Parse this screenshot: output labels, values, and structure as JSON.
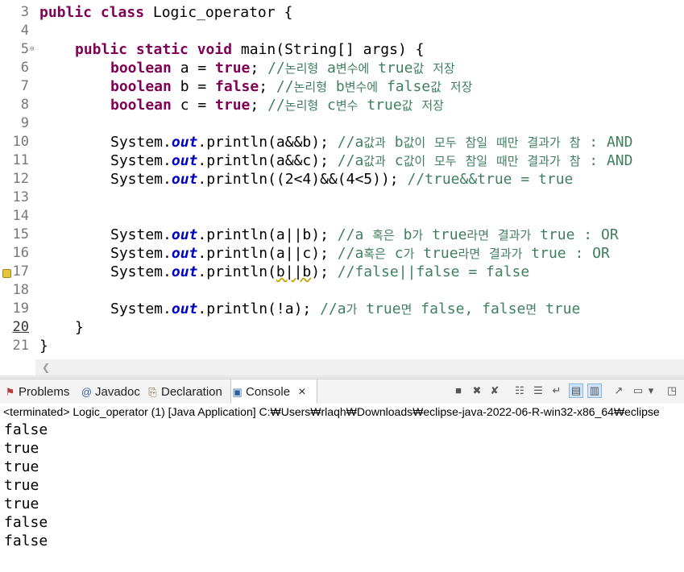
{
  "editor": {
    "line_numbers": [
      "3",
      "4",
      "5",
      "6",
      "7",
      "8",
      "9",
      "10",
      "11",
      "12",
      "13",
      "14",
      "15",
      "16",
      "17",
      "18",
      "19",
      "20",
      "21"
    ],
    "lines": {
      "l3": {
        "kw": "public class",
        "text": " Logic_operator {"
      },
      "l5": {
        "kw": "public static void",
        "text": " main(String[] args) {"
      },
      "l6": {
        "kw": "boolean",
        "a": " a = ",
        "kw2": "true",
        "b": "; ",
        "comment": "//논리형 a변수에 true값 저장"
      },
      "l7": {
        "kw": "boolean",
        "a": " b = ",
        "kw2": "false",
        "b": "; ",
        "comment": "//논리형 b변수에 false값 저장"
      },
      "l8": {
        "kw": "boolean",
        "a": " c = ",
        "kw2": "true",
        "b": "; ",
        "comment": "//논리형 c변수 true값 저장"
      },
      "l10": {
        "pre": "System.",
        "field": "out",
        "post": ".println(a&&b); ",
        "comment": "//a값과 b값이 모두 참일 때만 결과가 참 : AND"
      },
      "l11": {
        "pre": "System.",
        "field": "out",
        "post": ".println(a&&c); ",
        "comment": "//a값과 c값이 모두 참일 때만 결과가 참 : AND"
      },
      "l12": {
        "pre": "System.",
        "field": "out",
        "post": ".println((2<4)&&(4<5)); ",
        "comment": "//true&&true = true"
      },
      "l15": {
        "pre": "System.",
        "field": "out",
        "post": ".println(a||b); ",
        "comment": "//a 혹은 b가 true라면 결과가 true : OR"
      },
      "l16": {
        "pre": "System.",
        "field": "out",
        "post": ".println(a||c); ",
        "comment": "//a혹은 c가 true라면 결과가 true : OR"
      },
      "l17": {
        "pre": "System.",
        "field": "out",
        "post1": ".println(",
        "warn": "b||b",
        "post2": "); ",
        "comment": "//false||false = false"
      },
      "l19": {
        "pre": "System.",
        "field": "out",
        "post": ".println(!a); ",
        "comment": "//a가 true면 false, false면 true"
      },
      "l20": {
        "text": "}"
      },
      "l21": {
        "text": "}"
      }
    }
  },
  "views": {
    "tabs": [
      {
        "label": "Problems",
        "icon": "problems-icon"
      },
      {
        "label": "Javadoc",
        "icon": "javadoc-icon"
      },
      {
        "label": "Declaration",
        "icon": "declaration-icon"
      },
      {
        "label": "Console",
        "icon": "console-icon",
        "active": true
      }
    ],
    "close_glyph": "×"
  },
  "console": {
    "status": "<terminated> Logic_operator (1) [Java Application] C:₩Users₩rlaqh₩Downloads₩eclipse-java-2022-06-R-win32-x86_64₩eclipse",
    "output": [
      "false",
      "true",
      "true",
      "true",
      "true",
      "false",
      "false"
    ]
  }
}
